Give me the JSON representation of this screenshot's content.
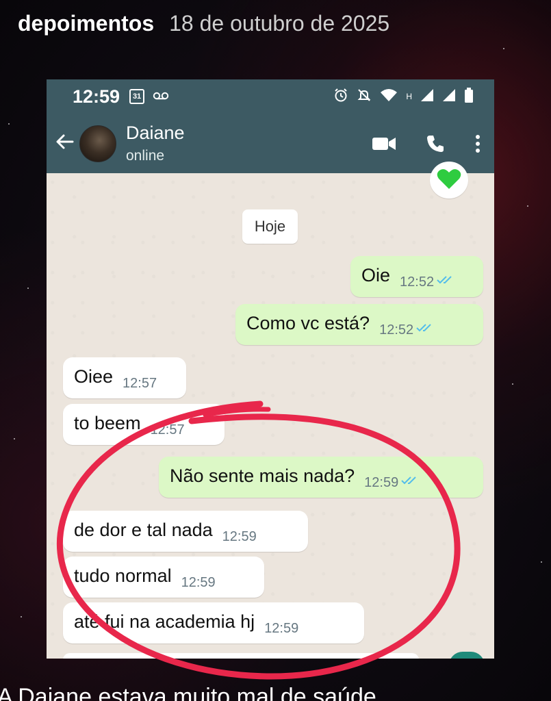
{
  "story": {
    "user": "depoimentos",
    "date": "18 de outubro de 2025"
  },
  "status_bar": {
    "time": "12:59",
    "calendar": "31",
    "network": "H"
  },
  "chat_header": {
    "name": "Daiane",
    "status": "online"
  },
  "date_chip": "Hoje",
  "messages": [
    {
      "dir": "out",
      "text": "Oie",
      "time": "12:52",
      "read": true
    },
    {
      "dir": "out",
      "text": "Como vc está?",
      "time": "12:52",
      "read": true
    },
    {
      "dir": "in",
      "text": "Oiee",
      "time": "12:57"
    },
    {
      "dir": "in",
      "text": "to beem",
      "time": "12:57"
    },
    {
      "dir": "out",
      "text": "Não sente mais nada?",
      "time": "12:59",
      "read": true
    },
    {
      "dir": "in",
      "text": "de dor e tal nada",
      "time": "12:59"
    },
    {
      "dir": "in",
      "text": "tudo normal",
      "time": "12:59"
    },
    {
      "dir": "in",
      "text": "até fui na academia hj",
      "time": "12:59"
    }
  ],
  "caption": "A Daiane estava muito mal de saúde",
  "colors": {
    "header": "#3d5a63",
    "outgoing": "#dcf8c6",
    "incoming": "#ffffff",
    "chat_bg": "#ece5dd",
    "read_ticks": "#53bdeb",
    "annotation": "#e8274b",
    "heart": "#2ecc40"
  }
}
